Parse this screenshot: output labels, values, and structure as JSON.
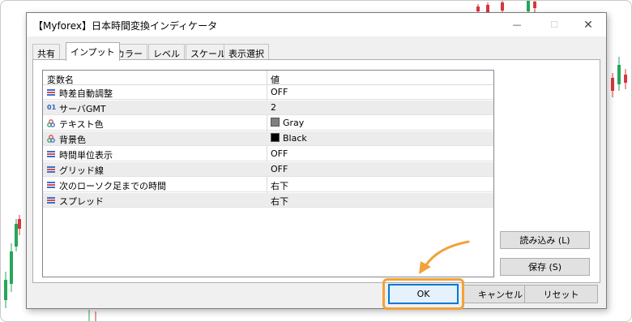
{
  "window": {
    "title": "【Myforex】日本時間変換インディケータ",
    "minimize_glyph": "—",
    "maximize_glyph": "☐",
    "close_glyph": "✕"
  },
  "tabs": [
    "共有",
    "インプット",
    "カラー",
    "レベル",
    "スケール",
    "表示選択"
  ],
  "active_tab": "インプット",
  "grid": {
    "headers": {
      "name": "変数名",
      "value": "値"
    },
    "rows": [
      {
        "icon": "params-icon",
        "name": "時差自動調整",
        "value": "OFF"
      },
      {
        "icon": "integer-icon",
        "icon_text": "01",
        "name": "サーバGMT",
        "value": "2"
      },
      {
        "icon": "color-icon",
        "name": "テキスト色",
        "value": "Gray",
        "swatch": "#808080"
      },
      {
        "icon": "color-icon",
        "name": "背景色",
        "value": "Black",
        "swatch": "#000000"
      },
      {
        "icon": "params-icon",
        "name": "時間単位表示",
        "value": "OFF"
      },
      {
        "icon": "params-icon",
        "name": "グリッド線",
        "value": "OFF"
      },
      {
        "icon": "params-icon",
        "name": "次のローソク足までの時間",
        "value": "右下"
      },
      {
        "icon": "params-icon",
        "name": "スプレッド",
        "value": "右下"
      }
    ]
  },
  "buttons": {
    "load": "読み込み (L)",
    "save": "保存 (S)",
    "ok": "OK",
    "cancel": "キャンセル",
    "reset": "リセット"
  },
  "colors": {
    "highlight": "#f2a23a",
    "ok_border": "#0078d7",
    "candle_up": "#26a65b",
    "candle_down": "#d9363e"
  }
}
